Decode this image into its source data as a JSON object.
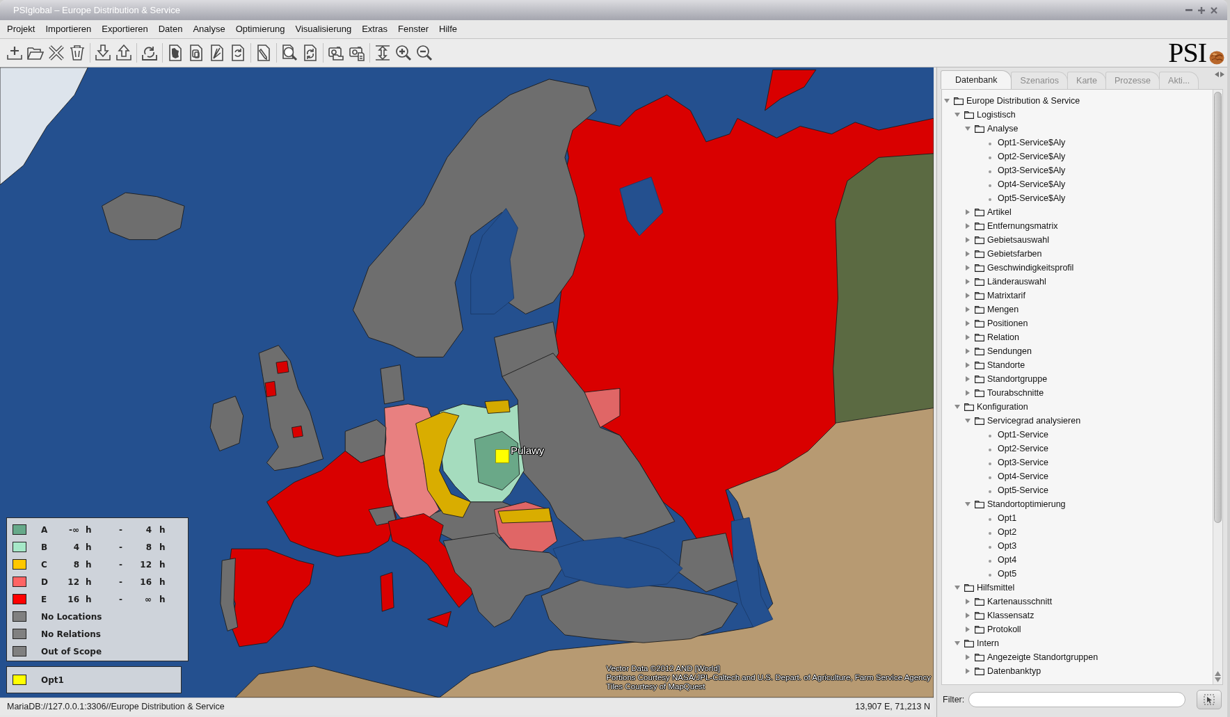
{
  "window": {
    "title": "PSIglobal – Europe Distribution & Service"
  },
  "menu": [
    "Projekt",
    "Importieren",
    "Exportieren",
    "Daten",
    "Analyse",
    "Optimierung",
    "Visualisierung",
    "Extras",
    "Fenster",
    "Hilfe"
  ],
  "logo": {
    "text": "PSI"
  },
  "map": {
    "markers": [
      {
        "label": "Pulawy"
      }
    ],
    "legend": [
      {
        "kind": "range",
        "label": "A",
        "from": "-∞",
        "from_unit": "h",
        "separator": "-",
        "to": "4",
        "to_unit": "h",
        "color": "#66a98a"
      },
      {
        "kind": "range",
        "label": "B",
        "from": "4",
        "from_unit": "h",
        "separator": "-",
        "to": "8",
        "to_unit": "h",
        "color": "#a6e8c8"
      },
      {
        "kind": "range",
        "label": "C",
        "from": "8",
        "from_unit": "h",
        "separator": "-",
        "to": "12",
        "to_unit": "h",
        "color": "#ffc800"
      },
      {
        "kind": "range",
        "label": "D",
        "from": "12",
        "from_unit": "h",
        "separator": "-",
        "to": "16",
        "to_unit": "h",
        "color": "#ff6464"
      },
      {
        "kind": "range",
        "label": "E",
        "from": "16",
        "from_unit": "h",
        "separator": "-",
        "to": "∞",
        "to_unit": "h",
        "color": "#ff0000"
      },
      {
        "kind": "plain",
        "label": "No Locations",
        "color": "#808080"
      },
      {
        "kind": "plain",
        "label": "No Relations",
        "color": "#808080"
      },
      {
        "kind": "plain",
        "label": "Out of Scope",
        "color": "#808080"
      }
    ],
    "scenario_legend": [
      {
        "label": "Opt1",
        "color": "#ffff00"
      }
    ],
    "attribution": [
      "Vector Data ©2012 AND [World]",
      "Portions Courtesy NASA/JPL-Caltech and U.S. Depart. of Agriculture, Farm Service Agency",
      "Tiles Courtesy of MapQuest"
    ]
  },
  "panel": {
    "tabs": [
      {
        "label": "Datenbank",
        "selected": true
      },
      {
        "label": "Szenarios",
        "selected": false
      },
      {
        "label": "Karte",
        "selected": false
      },
      {
        "label": "Prozesse",
        "selected": false
      },
      {
        "label": "Akti...",
        "selected": false
      }
    ],
    "tree": [
      {
        "kind": "folder",
        "label": "Europe Distribution & Service",
        "expanded": true,
        "children": [
          {
            "kind": "folder",
            "label": "Logistisch",
            "expanded": true,
            "children": [
              {
                "kind": "folder",
                "label": "Analyse",
                "expanded": true,
                "children": [
                  {
                    "kind": "leaf",
                    "label": "Opt1-Service$Aly"
                  },
                  {
                    "kind": "leaf",
                    "label": "Opt2-Service$Aly"
                  },
                  {
                    "kind": "leaf",
                    "label": "Opt3-Service$Aly"
                  },
                  {
                    "kind": "leaf",
                    "label": "Opt4-Service$Aly"
                  },
                  {
                    "kind": "leaf",
                    "label": "Opt5-Service$Aly"
                  }
                ]
              },
              {
                "kind": "folder",
                "label": "Artikel",
                "expanded": false
              },
              {
                "kind": "folder",
                "label": "Entfernungsmatrix",
                "expanded": false
              },
              {
                "kind": "folder",
                "label": "Gebietsauswahl",
                "expanded": false
              },
              {
                "kind": "folder",
                "label": "Gebietsfarben",
                "expanded": false
              },
              {
                "kind": "folder",
                "label": "Geschwindigkeitsprofil",
                "expanded": false
              },
              {
                "kind": "folder",
                "label": "Länderauswahl",
                "expanded": false
              },
              {
                "kind": "folder",
                "label": "Matrixtarif",
                "expanded": false
              },
              {
                "kind": "folder",
                "label": "Mengen",
                "expanded": false
              },
              {
                "kind": "folder",
                "label": "Positionen",
                "expanded": false
              },
              {
                "kind": "folder",
                "label": "Relation",
                "expanded": false
              },
              {
                "kind": "folder",
                "label": "Sendungen",
                "expanded": false
              },
              {
                "kind": "folder",
                "label": "Standorte",
                "expanded": false
              },
              {
                "kind": "folder",
                "label": "Standortgruppe",
                "expanded": false
              },
              {
                "kind": "folder",
                "label": "Tourabschnitte",
                "expanded": false
              }
            ]
          },
          {
            "kind": "folder",
            "label": "Konfiguration",
            "expanded": true,
            "children": [
              {
                "kind": "folder",
                "label": "Servicegrad analysieren",
                "expanded": true,
                "children": [
                  {
                    "kind": "leaf",
                    "label": "Opt1-Service"
                  },
                  {
                    "kind": "leaf",
                    "label": "Opt2-Service"
                  },
                  {
                    "kind": "leaf",
                    "label": "Opt3-Service"
                  },
                  {
                    "kind": "leaf",
                    "label": "Opt4-Service"
                  },
                  {
                    "kind": "leaf",
                    "label": "Opt5-Service"
                  }
                ]
              },
              {
                "kind": "folder",
                "label": "Standortoptimierung",
                "expanded": true,
                "children": [
                  {
                    "kind": "leaf",
                    "label": "Opt1"
                  },
                  {
                    "kind": "leaf",
                    "label": "Opt2"
                  },
                  {
                    "kind": "leaf",
                    "label": "Opt3"
                  },
                  {
                    "kind": "leaf",
                    "label": "Opt4"
                  },
                  {
                    "kind": "leaf",
                    "label": "Opt5"
                  }
                ]
              }
            ]
          },
          {
            "kind": "folder",
            "label": "Hilfsmittel",
            "expanded": true,
            "children": [
              {
                "kind": "folder",
                "label": "Kartenausschnitt",
                "expanded": false
              },
              {
                "kind": "folder",
                "label": "Klassensatz",
                "expanded": false
              },
              {
                "kind": "folder",
                "label": "Protokoll",
                "expanded": false
              }
            ]
          },
          {
            "kind": "folder",
            "label": "Intern",
            "expanded": true,
            "children": [
              {
                "kind": "folder",
                "label": "Angezeigte Standortgruppen",
                "expanded": false
              },
              {
                "kind": "folder",
                "label": "Datenbanktyp",
                "expanded": false
              }
            ]
          }
        ]
      }
    ],
    "filter": {
      "label": "Filter:"
    }
  },
  "status_bar": {
    "connection": "MariaDB://127.0.0.1:3306//Europe Distribution & Service",
    "coordinates": "13,907 E, 71,213 N"
  }
}
